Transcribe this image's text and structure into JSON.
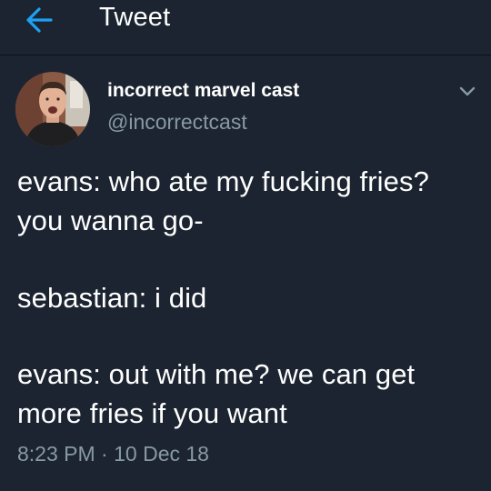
{
  "header": {
    "title": "Tweet",
    "back_icon": "arrow-left-icon",
    "accent_color": "#1da1f2"
  },
  "tweet": {
    "display_name": "incorrect marvel cast",
    "handle": "@incorrectcast",
    "menu_icon": "chevron-down-icon",
    "lines": [
      "evans: who ate my fucking fries?",
      "you wanna go-",
      "sebastian: i did",
      "evans: out with me? we can get",
      "more fries if you want"
    ],
    "time": "8:23 PM",
    "separator": "·",
    "date": "10 Dec 18"
  },
  "colors": {
    "background": "#1b2430",
    "text": "#ffffff",
    "secondary_text": "#8899a6"
  }
}
